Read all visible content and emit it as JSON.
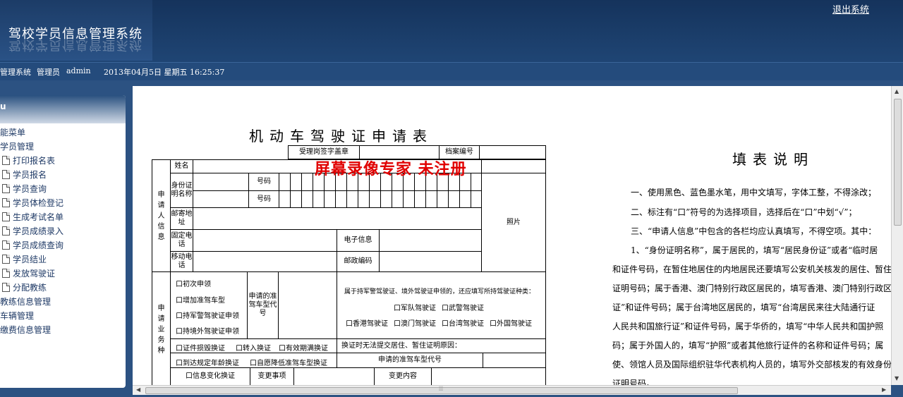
{
  "header": {
    "title": "驾校学员信息管理系统",
    "logout": "退出系统"
  },
  "infobar": {
    "system": "管理系统",
    "role": "管理员",
    "user": "admin",
    "datetime": "2013年04月5日 星期五 16:25:37"
  },
  "sidebar": {
    "head": "u",
    "items": [
      {
        "label": "能菜单",
        "type": "top"
      },
      {
        "label": "学员管理",
        "type": "top"
      },
      {
        "label": "打印报名表",
        "type": "sub"
      },
      {
        "label": "学员报名",
        "type": "sub"
      },
      {
        "label": "学员查询",
        "type": "sub"
      },
      {
        "label": "学员体检登记",
        "type": "sub"
      },
      {
        "label": "生成考试名单",
        "type": "sub"
      },
      {
        "label": "学员成绩录入",
        "type": "sub"
      },
      {
        "label": "学员成绩查询",
        "type": "sub"
      },
      {
        "label": "学员结业",
        "type": "sub"
      },
      {
        "label": "发放驾驶证",
        "type": "sub"
      },
      {
        "label": "分配教练",
        "type": "sub"
      },
      {
        "label": "教练信息管理",
        "type": "top"
      },
      {
        "label": "车辆管理",
        "type": "top"
      },
      {
        "label": "缴费信息管理",
        "type": "top"
      }
    ]
  },
  "form": {
    "title": "机动车驾驶证申请表",
    "watermark": "屏幕录像专家  未注册",
    "stamp": "受理岗签字盖章",
    "file_no": "档案编号",
    "applicant_info": "申请人信息",
    "name": "姓名",
    "idcert": "身份证明名称",
    "number1": "号码",
    "number2": "号码",
    "address": "邮寄地址",
    "photo": "照片",
    "fixed_phone": "固定电话",
    "email": "电子信息",
    "mobile": "移动电话",
    "postcode": "邮政编码",
    "biz_type": "申请业务种",
    "opt_first": "口初次申领",
    "opt_add": "口增加准驾车型",
    "opt_military": "口持军警驾驶证申领",
    "opt_foreign": "口持境外驾驶证申领",
    "class_code": "申请的准驾车型代号",
    "hold_note": "属于持军警驾驶证、境外驾驶证申领的，还应填写所持驾驶证种类：",
    "mil1": "口军队驾驶证",
    "mil2": "口武警驾驶证",
    "hk": "口香港驾驶证",
    "macau": "口澳门驾驶证",
    "tw": "口台湾驾驶证",
    "fr": "口外国驾驶证",
    "renew1": "口证件损毁换证",
    "renew2": "口转入换证",
    "renew3": "口有效期满换证",
    "renew_reason": "换证时无法提交居住、暂住证明原因：",
    "age1": "口到达规定年龄换证",
    "age2": "口自愿降低准驾车型换证",
    "class_code2": "申请的准驾车型代号",
    "info_change": "口信息变化换证",
    "change_item": "变更事项",
    "change_content": "变更内容"
  },
  "notes": {
    "title": "填表说明",
    "lines": [
      "一、使用黑色、蓝色墨水笔，用中文填写，字体工整，不得涂改；",
      "二、标注有“口”符号的为选择项目，选择后在“口”中划“√”；",
      "三、“申请人信息”中包含的各栏均应认真填写，不得空项。其中：",
      "1、“身份证明名称”，属于居民的，填写“居民身份证”或者“临时居",
      "和证件号码，在暂住地居住的内地居民还要填写公安机关核发的居住、暂住",
      "证明号码；属于香港、澳门特别行政区居民的，填写香港、澳门特别行政区",
      "证”和证件号码；属于台湾地区居民的，填写“台湾居民来往大陆通行证",
      "人民共和国旅行证”和证件号码，属于华侨的，填写“中华人民共和国护照",
      "码；属于外国人的，填写“护照”或者其他旅行证件的名称和证件号码；属",
      "使、领馆人员及国际组织驻华代表机构人员的，填写外交部核发的有效身份",
      "证明号码。"
    ]
  }
}
